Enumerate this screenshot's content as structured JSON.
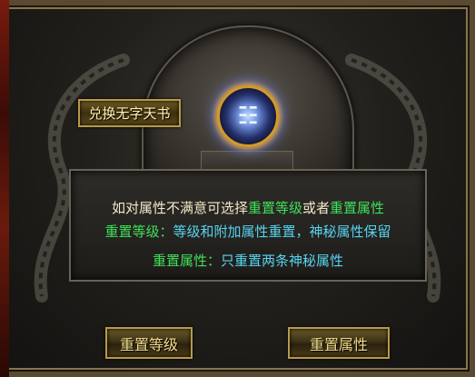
{
  "exchange_button": {
    "label": "兑换无字天书"
  },
  "orb": {
    "glyph": "☷",
    "icon": "book-orb-icon"
  },
  "info_panel": {
    "line1_prefix": "如对属性不满意可选择",
    "line1_reset_level": "重置等级",
    "line1_connector": "或者",
    "line1_reset_attr": "重置属性",
    "line2_label": "重置等级：",
    "line2_text": "等级和附加属性重置，神秘属性保留",
    "line3_label": "重置属性：",
    "line3_text": "只重置两条神秘属性"
  },
  "buttons": {
    "reset_level": "重置等级",
    "reset_attr": "重置属性"
  },
  "colors": {
    "green_highlight": "#3fe05a",
    "cyan_highlight": "#56d4f0",
    "button_text": "#f4dc8a"
  }
}
